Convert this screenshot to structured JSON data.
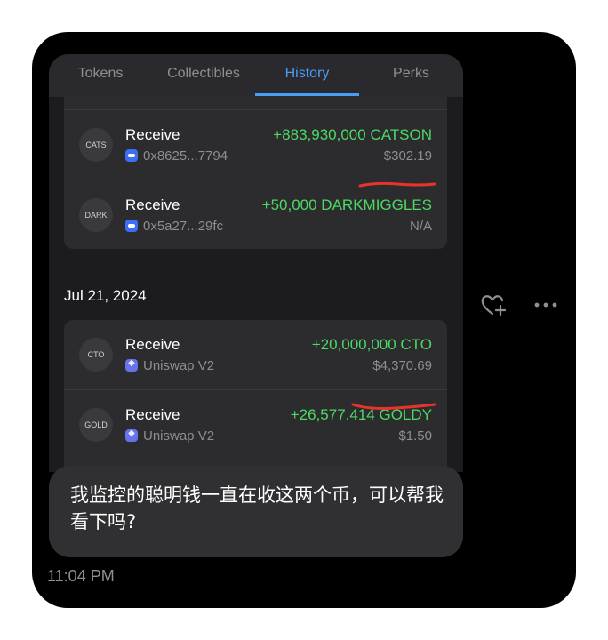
{
  "tabs": [
    {
      "label": "Tokens"
    },
    {
      "label": "Collectibles"
    },
    {
      "label": "History"
    },
    {
      "label": "Perks"
    }
  ],
  "active_tab": "History",
  "group1": {
    "rows": [
      {
        "icon_label": "CATS",
        "title": "Receive",
        "source": "0x8625...7794",
        "source_icon": "blue-pill-icon",
        "amount": "+883,930,000 CATSON",
        "usd": "$302.19",
        "underlined": true
      },
      {
        "icon_label": "DARK",
        "title": "Receive",
        "source": "0x5a27...29fc",
        "source_icon": "blue-pill-icon",
        "amount": "+50,000 DARKMIGGLES",
        "usd": "N/A",
        "underlined": false
      }
    ]
  },
  "group2": {
    "date": "Jul 21, 2024",
    "rows": [
      {
        "icon_label": "CTO",
        "title": "Receive",
        "source": "Uniswap V2",
        "source_icon": "ethereum-icon",
        "amount": "+20,000,000 CTO",
        "usd": "$4,370.69",
        "underlined": true
      },
      {
        "icon_label": "GOLD",
        "title": "Receive",
        "source": "Uniswap V2",
        "source_icon": "ethereum-icon",
        "amount": "+26,577.414 GOLDY",
        "usd": "$1.50",
        "underlined": false
      }
    ]
  },
  "message": {
    "text": "我监控的聪明钱一直在收这两个币，可以帮我看下吗?",
    "time": "11:04 PM"
  },
  "actions": {
    "like_icon": "heart-plus-icon",
    "more_icon": "more-icon"
  },
  "colors": {
    "accent": "#4a9cf7",
    "positive": "#4cd964",
    "annotation": "#e8332a",
    "background": "#000000"
  }
}
